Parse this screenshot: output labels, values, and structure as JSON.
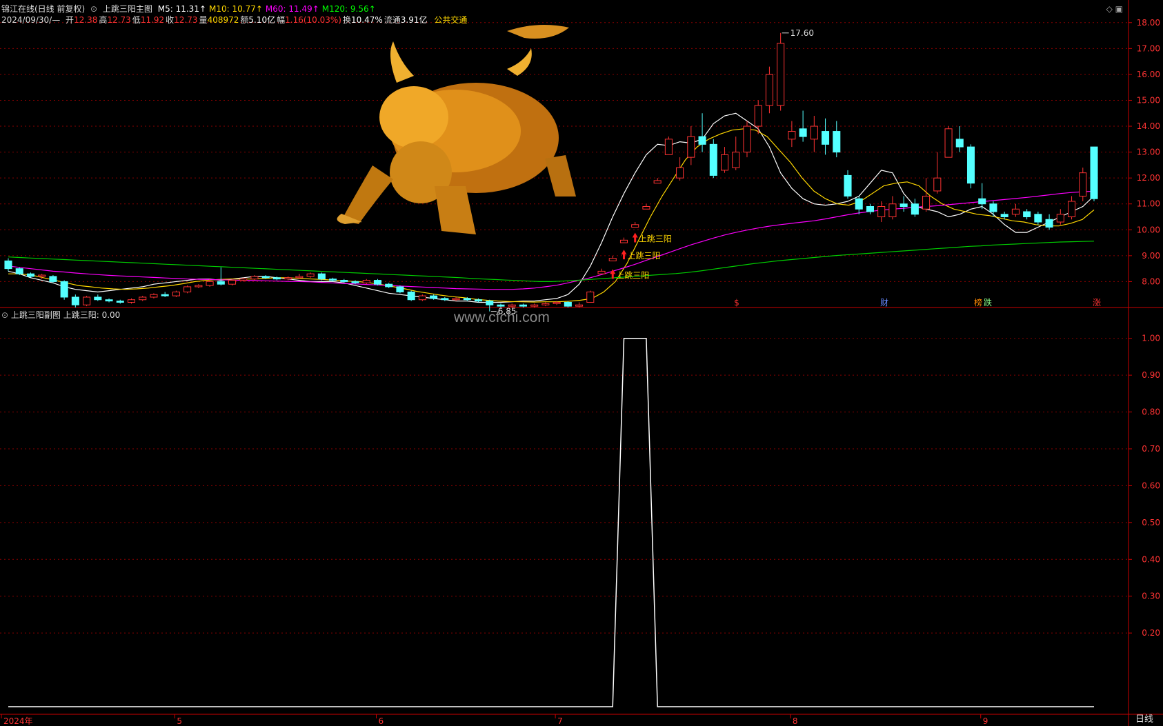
{
  "header": {
    "app_title": "锦江在线(日线 前复权)",
    "main_indicator": "上跳三阳主图",
    "ma": [
      {
        "label": "M5: 11.31",
        "color": "#ffffff"
      },
      {
        "label": "M10: 10.77",
        "color": "#ffd700"
      },
      {
        "label": "M60: 11.49",
        "color": "#ff00ff"
      },
      {
        "label": "M120: 9.56",
        "color": "#00ff00"
      }
    ],
    "date": "2024/09/30/—",
    "quote": [
      {
        "k": "开",
        "v": "12.38",
        "color": "#ff3333"
      },
      {
        "k": "高",
        "v": "12.73",
        "color": "#ff3333"
      },
      {
        "k": "低",
        "v": "11.92",
        "color": "#ff3333"
      },
      {
        "k": "收",
        "v": "12.73",
        "color": "#ff3333"
      },
      {
        "k": "量",
        "v": "408972",
        "color": "#ffd700"
      },
      {
        "k": "额",
        "v": "5.10亿",
        "color": "#ffffff"
      },
      {
        "k": "幅",
        "v": "1.16(10.03%)",
        "color": "#ff3333"
      },
      {
        "k": "换",
        "v": "10.47%",
        "color": "#ffffff"
      },
      {
        "k": "流通",
        "v": "3.91亿",
        "color": "#ffffff"
      }
    ],
    "sector": "公共交通",
    "arrow": "↑"
  },
  "indicator_header": {
    "name": "上跳三阳副图",
    "value_label": "上跳三阳: 0.00"
  },
  "watermark": "www.cfchi.com",
  "period": "日线",
  "colors": {
    "up": "#ff3333",
    "down": "#54ffff",
    "grid": "#8b0000",
    "axis": "#cc0000"
  },
  "chart_data": [
    {
      "type": "candlestick",
      "title": "上跳三阳主图",
      "ylim": [
        7.0,
        18.5
      ],
      "yticks": [
        "18.00",
        "17.00",
        "16.00",
        "15.00",
        "14.00",
        "13.00",
        "12.00",
        "11.00",
        "10.00",
        "9.00",
        "8.00"
      ],
      "x_month_labels": [
        "2024年",
        "5",
        "6",
        "7",
        "8",
        "9"
      ],
      "annotations": {
        "high_label": "17.60",
        "low_label": "6.85",
        "signal_label": "上跳三阳"
      },
      "event_tags": [
        {
          "text": "$",
          "color": "#ff3333"
        },
        {
          "text": "财",
          "color": "#6688ff"
        },
        {
          "text": "榜",
          "color": "#ff8800"
        },
        {
          "text": "跌",
          "color": "#88ff88"
        },
        {
          "text": "涨",
          "color": "#ff3333"
        }
      ],
      "series": [
        {
          "name": "M5",
          "color": "#ffffff",
          "values": [
            8.4,
            8.3,
            8.15,
            8.05,
            7.95,
            7.8,
            7.7,
            7.65,
            7.6,
            7.65,
            7.7,
            7.75,
            7.8,
            7.9,
            7.95,
            8.0,
            8.05,
            8.1,
            8.1,
            8.05,
            8.1,
            8.15,
            8.2,
            8.2,
            8.15,
            8.1,
            8.05,
            8.0,
            8.0,
            8.0,
            7.95,
            7.85,
            7.75,
            7.65,
            7.55,
            7.5,
            7.45,
            7.4,
            7.35,
            7.3,
            7.25,
            7.25,
            7.2,
            7.2,
            7.2,
            7.22,
            7.25,
            7.25,
            7.3,
            7.35,
            7.5,
            7.9,
            8.6,
            9.5,
            10.5,
            11.4,
            12.2,
            12.9,
            13.3,
            13.25,
            13.4,
            13.35,
            13.5,
            14.1,
            14.4,
            14.5,
            14.2,
            13.9,
            13.2,
            12.2,
            11.6,
            11.2,
            11.0,
            10.95,
            11.0,
            11.1,
            11.3,
            11.8,
            12.3,
            12.2,
            11.4,
            10.9,
            10.8,
            10.7,
            10.5,
            10.6,
            10.8,
            10.9,
            10.6,
            10.2,
            9.9,
            9.9,
            10.1,
            10.3,
            10.5,
            10.7,
            10.9,
            11.31
          ]
        },
        {
          "name": "M10",
          "color": "#ffd700",
          "values": [
            8.3,
            8.3,
            8.25,
            8.15,
            8.05,
            7.95,
            7.85,
            7.8,
            7.75,
            7.72,
            7.7,
            7.72,
            7.75,
            7.8,
            7.85,
            7.92,
            8.0,
            8.05,
            8.08,
            8.1,
            8.1,
            8.1,
            8.12,
            8.15,
            8.15,
            8.12,
            8.1,
            8.08,
            8.05,
            8.02,
            8.0,
            7.95,
            7.88,
            7.8,
            7.72,
            7.62,
            7.55,
            7.48,
            7.42,
            7.38,
            7.32,
            7.28,
            7.25,
            7.23,
            7.22,
            7.21,
            7.22,
            7.22,
            7.24,
            7.28,
            7.35,
            7.6,
            8.0,
            8.7,
            9.6,
            10.5,
            11.3,
            12.0,
            12.7,
            13.2,
            13.5,
            13.7,
            13.85,
            13.9,
            13.85,
            13.6,
            13.1,
            12.6,
            12.0,
            11.5,
            11.2,
            11.0,
            10.95,
            11.1,
            11.4,
            11.7,
            11.8,
            11.85,
            11.7,
            11.3,
            11.0,
            10.8,
            10.7,
            10.6,
            10.55,
            10.45,
            10.35,
            10.3,
            10.2,
            10.15,
            10.15,
            10.25,
            10.4,
            10.77
          ]
        },
        {
          "name": "M60",
          "color": "#ff00ff",
          "values": [
            8.6,
            8.55,
            8.5,
            8.45,
            8.4,
            8.37,
            8.33,
            8.3,
            8.27,
            8.24,
            8.22,
            8.2,
            8.18,
            8.16,
            8.14,
            8.12,
            8.1,
            8.09,
            8.08,
            8.07,
            8.06,
            8.05,
            8.04,
            8.03,
            8.02,
            8.01,
            8.0,
            7.99,
            7.97,
            7.95,
            7.93,
            7.91,
            7.89,
            7.87,
            7.85,
            7.83,
            7.81,
            7.79,
            7.77,
            7.75,
            7.73,
            7.72,
            7.71,
            7.7,
            7.7,
            7.7,
            7.72,
            7.75,
            7.8,
            7.86,
            7.95,
            8.05,
            8.15,
            8.27,
            8.4,
            8.53,
            8.67,
            8.82,
            8.97,
            9.12,
            9.27,
            9.42,
            9.55,
            9.68,
            9.8,
            9.9,
            9.99,
            10.07,
            10.14,
            10.2,
            10.25,
            10.3,
            10.35,
            10.42,
            10.5,
            10.58,
            10.65,
            10.71,
            10.76,
            10.8,
            10.83,
            10.87,
            10.9,
            10.93,
            10.97,
            11.01,
            11.05,
            11.09,
            11.13,
            11.17,
            11.21,
            11.25,
            11.3,
            11.35,
            11.4,
            11.44,
            11.47,
            11.49
          ]
        },
        {
          "name": "M120",
          "color": "#00cc00",
          "values": [
            8.95,
            8.93,
            8.91,
            8.89,
            8.87,
            8.85,
            8.83,
            8.81,
            8.79,
            8.77,
            8.75,
            8.73,
            8.71,
            8.69,
            8.67,
            8.65,
            8.63,
            8.61,
            8.59,
            8.57,
            8.55,
            8.53,
            8.51,
            8.49,
            8.47,
            8.45,
            8.43,
            8.41,
            8.39,
            8.37,
            8.35,
            8.33,
            8.31,
            8.29,
            8.27,
            8.25,
            8.23,
            8.21,
            8.19,
            8.17,
            8.15,
            8.12,
            8.1,
            8.08,
            8.06,
            8.04,
            8.02,
            8.0,
            8.0,
            8.02,
            8.04,
            8.07,
            8.1,
            8.13,
            8.16,
            8.19,
            8.22,
            8.25,
            8.28,
            8.31,
            8.35,
            8.4,
            8.46,
            8.52,
            8.58,
            8.64,
            8.7,
            8.75,
            8.8,
            8.84,
            8.88,
            8.92,
            8.96,
            9.0,
            9.03,
            9.06,
            9.09,
            9.12,
            9.15,
            9.18,
            9.21,
            9.24,
            9.27,
            9.3,
            9.33,
            9.36,
            9.38,
            9.41,
            9.43,
            9.45,
            9.47,
            9.49,
            9.51,
            9.53,
            9.54,
            9.55,
            9.56
          ]
        }
      ],
      "candles": [
        [
          8.8,
          8.5,
          8.9,
          8.4
        ],
        [
          8.5,
          8.3,
          8.55,
          8.25
        ],
        [
          8.3,
          8.2,
          8.35,
          8.15
        ],
        [
          8.2,
          8.25,
          8.3,
          8.1
        ],
        [
          8.2,
          8.0,
          8.25,
          7.95
        ],
        [
          8.0,
          7.4,
          8.05,
          7.3
        ],
        [
          7.4,
          7.1,
          7.5,
          7.0
        ],
        [
          7.1,
          7.4,
          7.45,
          7.05
        ],
        [
          7.4,
          7.3,
          7.5,
          7.25
        ],
        [
          7.3,
          7.25,
          7.35,
          7.2
        ],
        [
          7.25,
          7.2,
          7.3,
          7.15
        ],
        [
          7.2,
          7.3,
          7.35,
          7.15
        ],
        [
          7.3,
          7.4,
          7.45,
          7.25
        ],
        [
          7.4,
          7.5,
          7.55,
          7.35
        ],
        [
          7.5,
          7.45,
          7.6,
          7.4
        ],
        [
          7.45,
          7.6,
          7.65,
          7.4
        ],
        [
          7.6,
          7.8,
          7.85,
          7.55
        ],
        [
          7.8,
          7.85,
          7.9,
          7.75
        ],
        [
          7.85,
          8.0,
          8.1,
          7.8
        ],
        [
          8.0,
          7.9,
          8.55,
          7.85
        ],
        [
          7.9,
          8.05,
          8.1,
          7.85
        ],
        [
          8.05,
          8.1,
          8.15,
          8.0
        ],
        [
          8.1,
          8.2,
          8.25,
          8.05
        ],
        [
          8.2,
          8.15,
          8.25,
          8.1
        ],
        [
          8.15,
          8.1,
          8.2,
          8.05
        ],
        [
          8.1,
          8.15,
          8.2,
          8.05
        ],
        [
          8.15,
          8.2,
          8.3,
          8.1
        ],
        [
          8.2,
          8.3,
          8.35,
          8.15
        ],
        [
          8.3,
          8.1,
          8.35,
          8.05
        ],
        [
          8.1,
          8.05,
          8.15,
          8.0
        ],
        [
          8.05,
          8.0,
          8.1,
          7.95
        ],
        [
          8.0,
          7.95,
          8.05,
          7.9
        ],
        [
          7.95,
          8.05,
          8.1,
          7.9
        ],
        [
          8.05,
          7.9,
          8.1,
          7.85
        ],
        [
          7.9,
          7.8,
          7.95,
          7.75
        ],
        [
          7.8,
          7.6,
          7.85,
          7.55
        ],
        [
          7.6,
          7.3,
          7.65,
          7.25
        ],
        [
          7.3,
          7.45,
          7.5,
          7.25
        ],
        [
          7.45,
          7.35,
          7.5,
          7.3
        ],
        [
          7.35,
          7.3,
          7.4,
          7.25
        ],
        [
          7.3,
          7.35,
          7.4,
          7.25
        ],
        [
          7.35,
          7.3,
          7.4,
          7.25
        ],
        [
          7.3,
          7.25,
          7.35,
          7.2
        ],
        [
          7.25,
          7.1,
          7.3,
          6.85
        ],
        [
          7.1,
          7.05,
          7.15,
          7.0
        ],
        [
          7.05,
          7.1,
          7.15,
          7.0
        ],
        [
          7.1,
          7.05,
          7.15,
          7.0
        ],
        [
          7.05,
          7.1,
          7.15,
          7.0
        ],
        [
          7.1,
          7.15,
          7.2,
          7.05
        ],
        [
          7.15,
          7.2,
          7.25,
          7.1
        ],
        [
          7.2,
          7.05,
          7.25,
          7.0
        ],
        [
          7.05,
          7.1,
          7.2,
          7.0
        ],
        [
          7.2,
          7.6,
          7.65,
          7.2
        ],
        [
          8.3,
          8.4,
          8.5,
          8.3
        ],
        [
          8.8,
          8.9,
          9.0,
          8.8
        ],
        [
          9.5,
          9.6,
          9.7,
          9.5
        ],
        [
          10.1,
          10.2,
          10.3,
          10.1
        ],
        [
          10.8,
          10.9,
          11.0,
          10.8
        ],
        [
          11.8,
          11.9,
          12.0,
          11.8
        ],
        [
          12.9,
          13.5,
          13.6,
          12.9
        ],
        [
          12.0,
          12.4,
          12.8,
          11.9
        ],
        [
          12.8,
          13.6,
          14.0,
          12.5
        ],
        [
          13.6,
          13.3,
          14.5,
          13.0
        ],
        [
          13.3,
          12.1,
          13.5,
          12.0
        ],
        [
          12.3,
          12.9,
          13.2,
          12.2
        ],
        [
          12.4,
          13.0,
          13.6,
          12.3
        ],
        [
          13.0,
          14.0,
          14.2,
          12.8
        ],
        [
          14.0,
          14.8,
          15.0,
          13.7
        ],
        [
          14.8,
          16.0,
          16.3,
          14.5
        ],
        [
          14.8,
          17.2,
          17.6,
          14.6
        ],
        [
          13.5,
          13.8,
          14.2,
          13.2
        ],
        [
          13.9,
          13.6,
          14.6,
          13.4
        ],
        [
          13.5,
          14.0,
          14.4,
          13.0
        ],
        [
          13.8,
          13.3,
          14.3,
          12.9
        ],
        [
          13.8,
          13.0,
          14.2,
          12.8
        ],
        [
          12.1,
          11.3,
          12.3,
          11.2
        ],
        [
          11.2,
          10.8,
          11.3,
          10.6
        ],
        [
          10.9,
          10.7,
          11.0,
          10.6
        ],
        [
          10.5,
          10.9,
          11.1,
          10.3
        ],
        [
          10.5,
          11.0,
          11.3,
          10.4
        ],
        [
          11.0,
          10.9,
          11.3,
          10.7
        ],
        [
          11.0,
          10.6,
          11.2,
          10.5
        ],
        [
          10.8,
          11.3,
          12.0,
          10.7
        ],
        [
          11.5,
          12.0,
          13.0,
          11.4
        ],
        [
          12.8,
          13.9,
          14.0,
          12.8
        ],
        [
          13.5,
          13.2,
          14.0,
          13.0
        ],
        [
          13.2,
          11.8,
          13.3,
          11.6
        ],
        [
          11.2,
          11.0,
          11.8,
          10.8
        ],
        [
          11.0,
          10.7,
          11.1,
          10.5
        ],
        [
          10.6,
          10.5,
          10.7,
          10.4
        ],
        [
          10.6,
          10.8,
          11.0,
          10.5
        ],
        [
          10.7,
          10.5,
          10.8,
          10.4
        ],
        [
          10.6,
          10.3,
          10.7,
          10.2
        ],
        [
          10.4,
          10.1,
          10.6,
          10.0
        ],
        [
          10.3,
          10.6,
          10.8,
          10.2
        ],
        [
          10.5,
          11.1,
          11.3,
          10.4
        ],
        [
          11.3,
          12.2,
          12.4,
          11.1
        ],
        [
          13.2,
          11.2,
          13.2,
          11.1
        ]
      ]
    },
    {
      "type": "line",
      "title": "上跳三阳副图",
      "ylim": [
        0,
        1.05
      ],
      "yticks": [
        "1.00",
        "0.90",
        "0.80",
        "0.70",
        "0.60",
        "0.50",
        "0.40",
        "0.30",
        "0.20"
      ],
      "series": [
        {
          "name": "上跳三阳",
          "color": "#ffffff",
          "values": [
            0,
            0,
            0,
            0,
            0,
            0,
            0,
            0,
            0,
            0,
            0,
            0,
            0,
            0,
            0,
            0,
            0,
            0,
            0,
            0,
            0,
            0,
            0,
            0,
            0,
            0,
            0,
            0,
            0,
            0,
            0,
            0,
            0,
            0,
            0,
            0,
            0,
            0,
            0,
            0,
            0,
            0,
            0,
            0,
            0,
            0,
            0,
            0,
            0,
            0,
            0,
            0,
            0,
            0,
            0,
            1,
            1,
            1,
            0,
            0,
            0,
            0,
            0,
            0,
            0,
            0,
            0,
            0,
            0,
            0,
            0,
            0,
            0,
            0,
            0,
            0,
            0,
            0,
            0,
            0,
            0,
            0,
            0,
            0,
            0,
            0,
            0,
            0,
            0,
            0,
            0,
            0,
            0,
            0,
            0,
            0,
            0,
            0
          ]
        }
      ]
    }
  ]
}
